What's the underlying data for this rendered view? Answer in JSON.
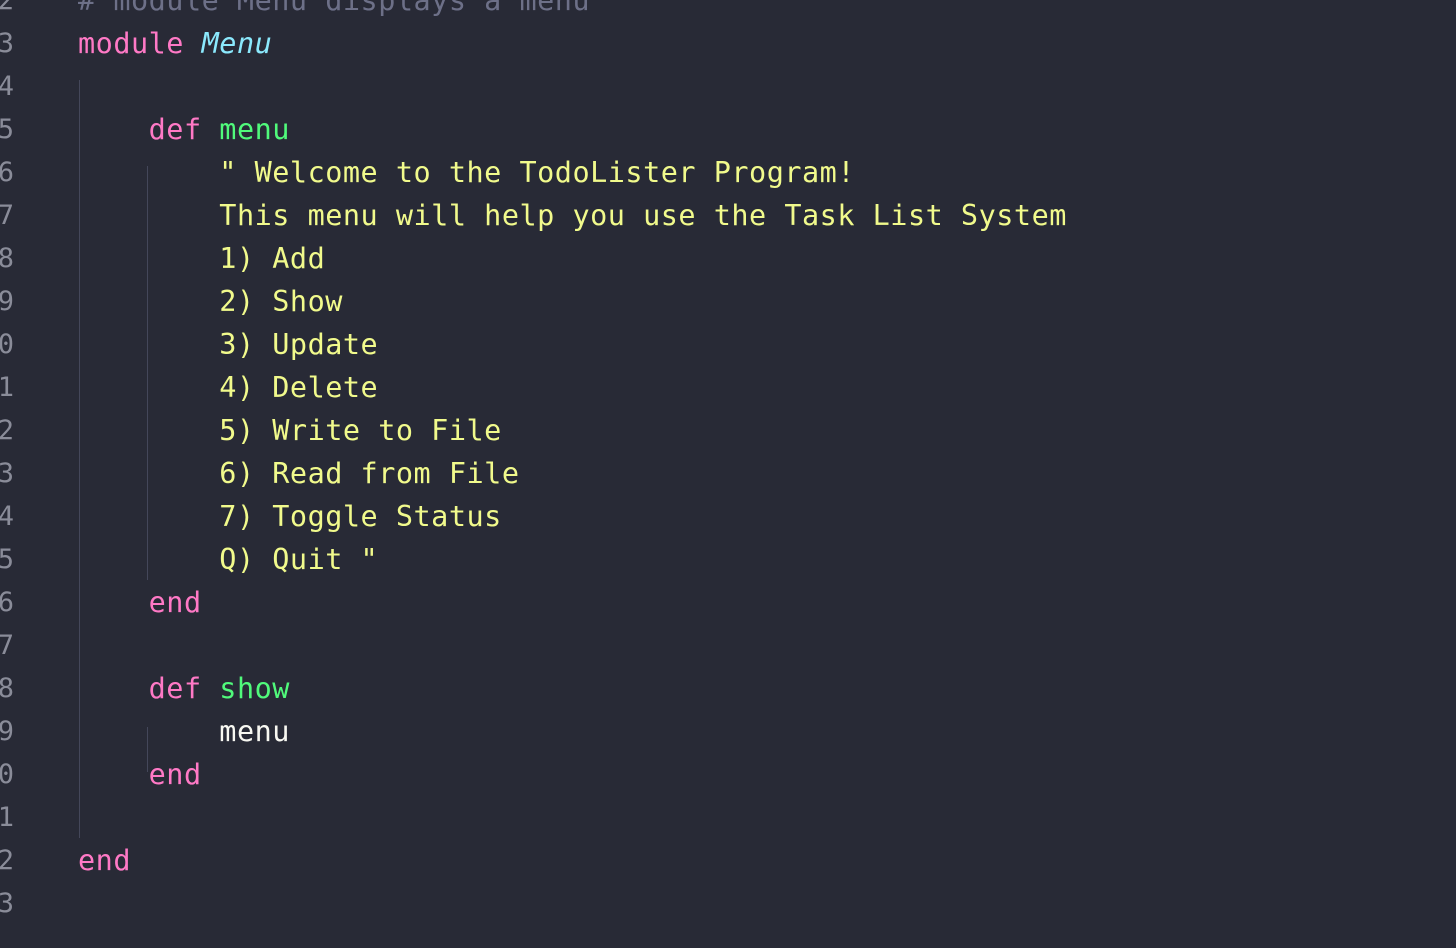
{
  "editor": {
    "lines": [
      {
        "num": "2",
        "tokens": [
          {
            "type": "comment",
            "text": "# module Menu displays a menu"
          }
        ]
      },
      {
        "num": "3",
        "tokens": [
          {
            "type": "keyword",
            "text": "module"
          },
          {
            "type": "plain",
            "text": " "
          },
          {
            "type": "class",
            "text": "Menu"
          }
        ]
      },
      {
        "num": "4",
        "tokens": []
      },
      {
        "num": "5",
        "tokens": [
          {
            "type": "plain",
            "text": "    "
          },
          {
            "type": "keyword",
            "text": "def"
          },
          {
            "type": "plain",
            "text": " "
          },
          {
            "type": "fn",
            "text": "menu"
          }
        ]
      },
      {
        "num": "6",
        "tokens": [
          {
            "type": "plain",
            "text": "        "
          },
          {
            "type": "string",
            "text": "\" Welcome to the TodoLister Program!"
          }
        ]
      },
      {
        "num": "7",
        "tokens": [
          {
            "type": "plain",
            "text": "        "
          },
          {
            "type": "string",
            "text": "This menu will help you use the Task List System"
          }
        ]
      },
      {
        "num": "8",
        "tokens": [
          {
            "type": "plain",
            "text": "        "
          },
          {
            "type": "string",
            "text": "1) Add"
          }
        ]
      },
      {
        "num": "9",
        "tokens": [
          {
            "type": "plain",
            "text": "        "
          },
          {
            "type": "string",
            "text": "2) Show"
          }
        ]
      },
      {
        "num": "0",
        "tokens": [
          {
            "type": "plain",
            "text": "        "
          },
          {
            "type": "string",
            "text": "3) Update"
          }
        ]
      },
      {
        "num": "1",
        "tokens": [
          {
            "type": "plain",
            "text": "        "
          },
          {
            "type": "string",
            "text": "4) Delete"
          }
        ]
      },
      {
        "num": "2",
        "tokens": [
          {
            "type": "plain",
            "text": "        "
          },
          {
            "type": "string",
            "text": "5) Write to File"
          }
        ]
      },
      {
        "num": "3",
        "tokens": [
          {
            "type": "plain",
            "text": "        "
          },
          {
            "type": "string",
            "text": "6) Read from File"
          }
        ]
      },
      {
        "num": "4",
        "tokens": [
          {
            "type": "plain",
            "text": "        "
          },
          {
            "type": "string",
            "text": "7) Toggle Status"
          }
        ]
      },
      {
        "num": "5",
        "tokens": [
          {
            "type": "plain",
            "text": "        "
          },
          {
            "type": "string",
            "text": "Q) Quit \""
          }
        ]
      },
      {
        "num": "6",
        "tokens": [
          {
            "type": "plain",
            "text": "    "
          },
          {
            "type": "keyword",
            "text": "end"
          }
        ]
      },
      {
        "num": "7",
        "tokens": []
      },
      {
        "num": "8",
        "tokens": [
          {
            "type": "plain",
            "text": "    "
          },
          {
            "type": "keyword",
            "text": "def"
          },
          {
            "type": "plain",
            "text": " "
          },
          {
            "type": "fn",
            "text": "show"
          }
        ]
      },
      {
        "num": "9",
        "tokens": [
          {
            "type": "plain",
            "text": "        "
          },
          {
            "type": "plain",
            "text": "menu"
          }
        ]
      },
      {
        "num": "0",
        "tokens": [
          {
            "type": "plain",
            "text": "    "
          },
          {
            "type": "keyword",
            "text": "end"
          }
        ]
      },
      {
        "num": "1",
        "tokens": []
      },
      {
        "num": "2",
        "tokens": [
          {
            "type": "keyword",
            "text": "end"
          }
        ]
      },
      {
        "num": "3",
        "tokens": []
      }
    ]
  },
  "colors": {
    "background": "#282a36",
    "keyword": "#ff79c6",
    "class": "#8be9fd",
    "function": "#50fa7b",
    "string": "#f1fa8c",
    "comment": "#6d7088",
    "plain": "#f8f8f2",
    "gutter": "#8a8c99"
  }
}
